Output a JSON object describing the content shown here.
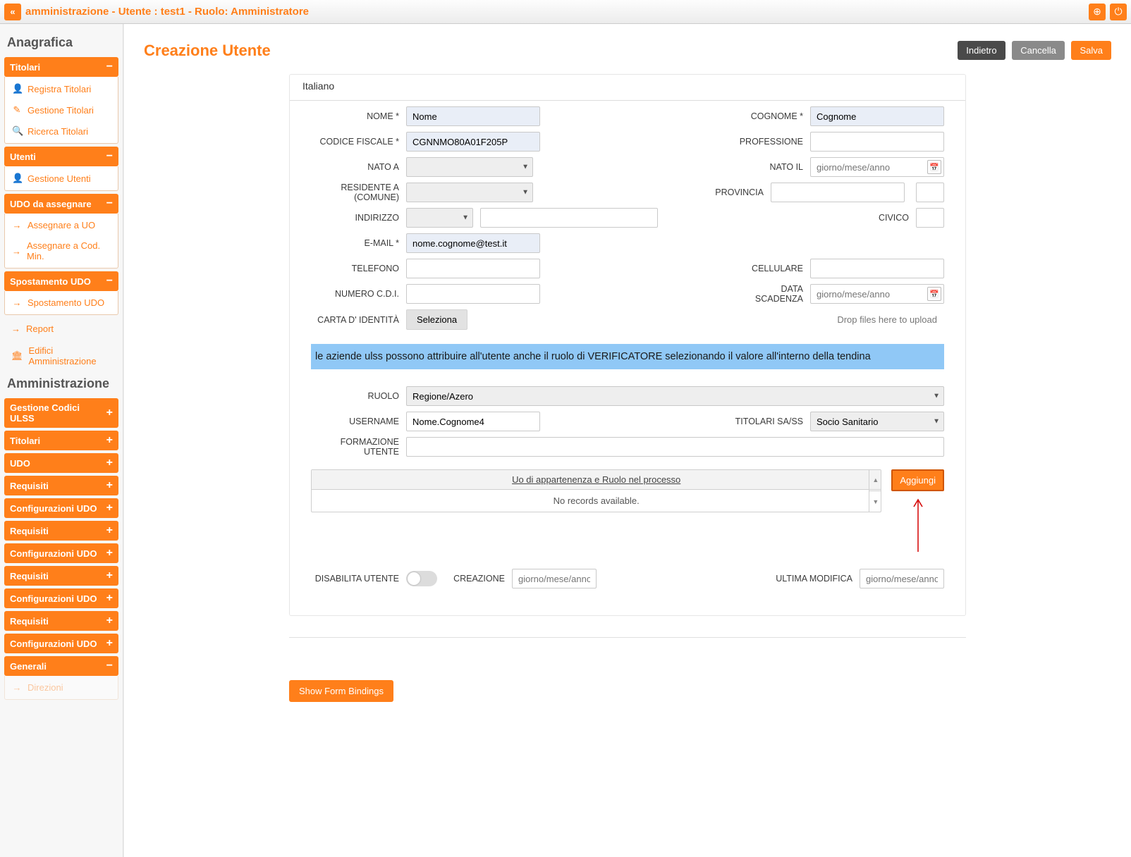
{
  "topbar": {
    "breadcrumb": "amministrazione - Utente : test1 - Ruolo: Amministratore"
  },
  "sidebar": {
    "section1_title": "Anagrafica",
    "titolari": {
      "header": "Titolari",
      "items": [
        "Registra Titolari",
        "Gestione Titolari",
        "Ricerca Titolari"
      ]
    },
    "utenti": {
      "header": "Utenti",
      "items": [
        "Gestione Utenti"
      ]
    },
    "udo_assegnare": {
      "header": "UDO da assegnare",
      "items": [
        "Assegnare a UO",
        "Assegnare a Cod. Min."
      ]
    },
    "spostamento": {
      "header": "Spostamento UDO",
      "items": [
        "Spostamento UDO"
      ]
    },
    "links": [
      "Report",
      "Edifici Amministrazione"
    ],
    "section2_title": "Amministrazione",
    "collapsed": [
      "Gestione Codici ULSS",
      "Titolari",
      "UDO",
      "Requisiti",
      "Configurazioni UDO",
      "Requisiti",
      "Configurazioni UDO",
      "Requisiti",
      "Configurazioni UDO",
      "Requisiti",
      "Configurazioni UDO",
      "Generali"
    ],
    "generali_item": "Direzioni"
  },
  "page": {
    "title": "Creazione Utente",
    "buttons": {
      "back": "Indietro",
      "cancel": "Cancella",
      "save": "Salva"
    },
    "tab": "Italiano"
  },
  "form": {
    "labels": {
      "nome": "NOME *",
      "cognome": "COGNOME *",
      "codice_fiscale": "CODICE FISCALE *",
      "professione": "PROFESSIONE",
      "nato_a": "NATO A",
      "nato_il": "NATO IL",
      "residente": "RESIDENTE A (COMUNE)",
      "provincia": "PROVINCIA",
      "indirizzo": "INDIRIZZO",
      "civico": "CIVICO",
      "email": "E-MAIL *",
      "telefono": "TELEFONO",
      "cellulare": "CELLULARE",
      "numero_cdi": "NUMERO C.D.I.",
      "data_scadenza": "DATA SCADENZA",
      "carta_identita": "CARTA D' IDENTITÀ",
      "ruolo": "RUOLO",
      "username": "USERNAME",
      "titolari_sass": "TITOLARI SA/SS",
      "formazione": "FORMAZIONE UTENTE",
      "disabilita": "DISABILITA UTENTE",
      "creazione": "CREAZIONE",
      "ultima_modifica": "ULTIMA MODIFICA"
    },
    "values": {
      "nome": "Nome",
      "cognome": "Cognome",
      "codice_fiscale": "CGNNMO80A01F205P",
      "email": "nome.cognome@test.it",
      "ruolo": "Regione/Azero",
      "username": "Nome.Cognome4",
      "titolari_sass": "Socio Sanitario"
    },
    "placeholders": {
      "date": "giorno/mese/anno"
    },
    "file": {
      "select": "Seleziona",
      "drop": "Drop files here to upload"
    },
    "note": "le aziende ulss possono attribuire all'utente anche il ruolo di VERIFICATORE selezionando il valore all'interno della tendina",
    "subtable": {
      "header": "Uo di appartenenza e Ruolo nel processo",
      "empty": "No records available.",
      "add": "Aggiungi"
    },
    "show_bindings": "Show Form Bindings"
  }
}
